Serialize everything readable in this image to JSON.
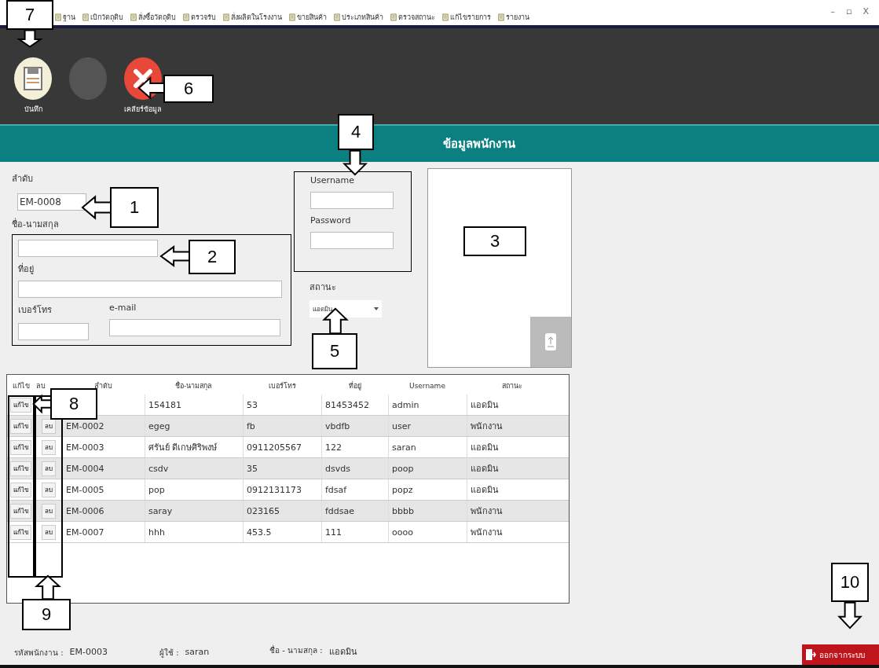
{
  "window_controls": [
    "–",
    "▫",
    "X"
  ],
  "menu": [
    {
      "label": "ฐาน"
    },
    {
      "label": "เบิกวัตถุดิบ"
    },
    {
      "label": "สั่งซื้อวัตถุดิบ"
    },
    {
      "label": "ตรวจรับ"
    },
    {
      "label": "สั่งผลิตในโรงงาน"
    },
    {
      "label": "ขายสินค้า"
    },
    {
      "label": "ประเภทสินค้า"
    },
    {
      "label": "ตรวจสถานะ"
    },
    {
      "label": "แก้ไขรายการ"
    },
    {
      "label": "รายงาน"
    }
  ],
  "toolbar": [
    {
      "kind": "save",
      "label": "บันทึก",
      "disabled": false
    },
    {
      "kind": "blank",
      "disabled": true
    },
    {
      "kind": "clear",
      "label": "เคลียร์ข้อมูล",
      "disabled": false
    }
  ],
  "section_title": "ข้อมูลพนักงาน",
  "form": {
    "id_label": "ลำดับ",
    "id_value": "EM-0008",
    "name_label": "ชื่อ-นามสกุล",
    "address_label": "ที่อยู่",
    "phone_label": "เบอร์โทร",
    "email_label": "e-mail",
    "username_label": "Username",
    "password_label": "Password",
    "status_label": "สถานะ",
    "status_value": "แอดมิน"
  },
  "table": {
    "columns": [
      "แก้ไข",
      "ลบ",
      "ลำดับ",
      "ชื่อ-นามสกุล",
      "เบอร์โทร",
      "ที่อยู่",
      "Username",
      "สถานะ"
    ],
    "rows": [
      {
        "edit": "แก้ไข",
        "cells": [
          "",
          "154181",
          "53",
          "81453452",
          "admin",
          "แอดมิน"
        ]
      },
      {
        "edit": "แก้ไข",
        "delete": "ลบ",
        "cells": [
          "EM-0002",
          "egeg",
          "fb",
          "vbdfb",
          "user",
          "พนักงาน"
        ]
      },
      {
        "edit": "แก้ไข",
        "delete": "ลบ",
        "cells": [
          "EM-0003",
          "ศรันย์ ดีเกษศิริพงษ์",
          "0911205567",
          "122",
          "saran",
          "แอดมิน"
        ]
      },
      {
        "edit": "แก้ไข",
        "delete": "ลบ",
        "cells": [
          "EM-0004",
          "csdv",
          "35",
          "dsvds",
          "poop",
          "แอดมิน"
        ]
      },
      {
        "edit": "แก้ไข",
        "delete": "ลบ",
        "cells": [
          "EM-0005",
          "pop",
          "0912131173",
          "fdsaf",
          "popz",
          "แอดมิน"
        ]
      },
      {
        "edit": "แก้ไข",
        "delete": "ลบ",
        "cells": [
          "EM-0006",
          "saray",
          "023165",
          "fddsae",
          "bbbb",
          "พนักงาน"
        ]
      },
      {
        "edit": "แก้ไข",
        "delete": "ลบ",
        "cells": [
          "EM-0007",
          "hhh",
          "453.5",
          "111",
          "oooo",
          "พนักงาน"
        ]
      }
    ]
  },
  "status_bar": [
    {
      "label": "รหัสพนักงาน :",
      "value": "EM-0003"
    },
    {
      "label": "ผู้ใช้ :",
      "value": "saran"
    },
    {
      "label": "ชื่อ - นามสกุล :",
      "value": "แอดมิน"
    }
  ],
  "exit_button": "ออกจากระบบ",
  "callouts": [
    {
      "label": "7",
      "kind": "down"
    },
    {
      "label": "6",
      "kind": "left"
    },
    {
      "label": "4",
      "kind": "down"
    },
    {
      "label": "1",
      "kind": "left"
    },
    {
      "label": "2",
      "kind": "left"
    },
    {
      "label": "3",
      "kind": "plain"
    },
    {
      "label": "5",
      "kind": "up"
    },
    {
      "label": "8",
      "kind": "left"
    },
    {
      "label": "9",
      "kind": "up"
    },
    {
      "label": "10",
      "kind": "down"
    }
  ]
}
